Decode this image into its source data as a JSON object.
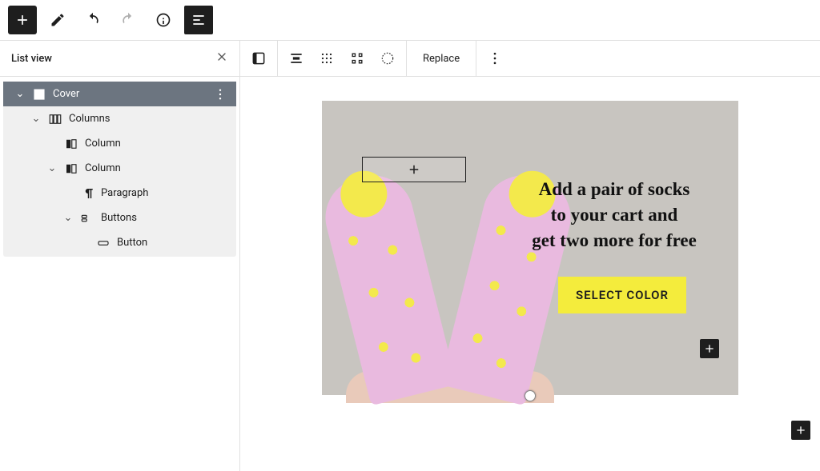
{
  "colors": {
    "accent": "#f4ec3c",
    "selection": "#6c7580",
    "dark": "#1e1e1e"
  },
  "topToolbar": {
    "addBlock": "add-block",
    "tools": "tools",
    "undo": "undo",
    "redo": "redo",
    "info": "details",
    "outline": "list-view"
  },
  "listView": {
    "title": "List view",
    "close": "close",
    "tree": [
      {
        "icon": "cover",
        "label": "Cover",
        "depth": 0,
        "expanded": true,
        "selected": true,
        "hasMore": true
      },
      {
        "icon": "columns",
        "label": "Columns",
        "depth": 1,
        "expanded": true
      },
      {
        "icon": "column",
        "label": "Column",
        "depth": 2
      },
      {
        "icon": "column",
        "label": "Column",
        "depth": 2,
        "expanded": true
      },
      {
        "icon": "paragraph",
        "label": "Paragraph",
        "depth": 3
      },
      {
        "icon": "buttons",
        "label": "Buttons",
        "depth": 3,
        "expanded": true
      },
      {
        "icon": "button",
        "label": "Button",
        "depth": 4
      }
    ]
  },
  "blockToolbar": {
    "blockIcon": "cover",
    "align": "align",
    "contentPosition": "content-position",
    "fullHeight": "full-height",
    "duotone": "duotone",
    "replace": "Replace",
    "more": "more-options"
  },
  "cover": {
    "heading_l1": "Add a pair of socks",
    "heading_l2": "to your cart and",
    "heading_l3": "get two more for free",
    "cta": "SELECT COLOR"
  }
}
